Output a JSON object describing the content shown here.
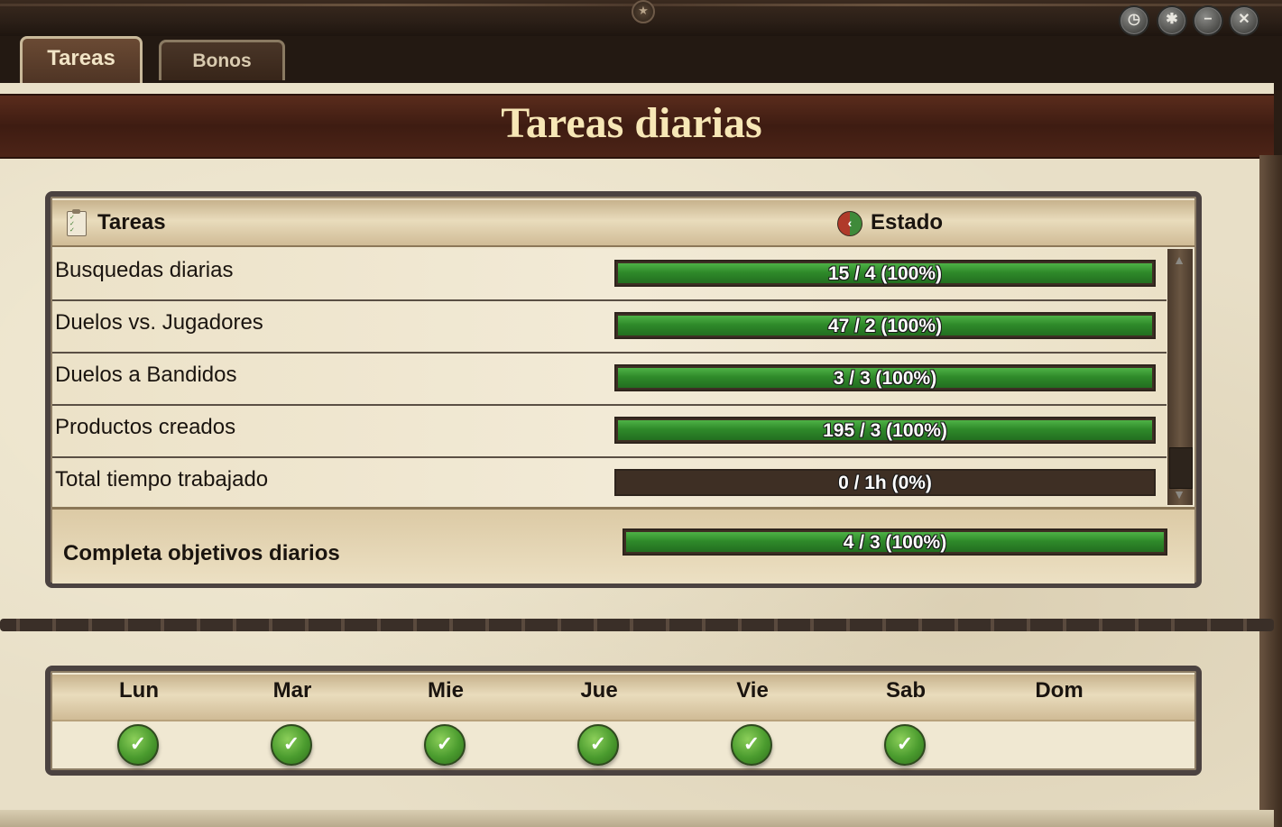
{
  "window": {
    "top_ornament": "star-icon",
    "buttons": [
      {
        "name": "history-button",
        "icon": "clock-icon",
        "glyph": "◷"
      },
      {
        "name": "settings-button",
        "icon": "gear-icon",
        "glyph": "✱"
      },
      {
        "name": "minimize-button",
        "icon": "minus-icon",
        "glyph": "−"
      },
      {
        "name": "close-button",
        "icon": "close-icon",
        "glyph": "✕"
      }
    ]
  },
  "tabs": [
    {
      "label": "Tareas",
      "active": true
    },
    {
      "label": "Bonos",
      "active": false
    }
  ],
  "page": {
    "title": "Tareas diarias"
  },
  "table": {
    "col_tasks": "Tareas",
    "col_status": "Estado",
    "rows": [
      {
        "label": "Busquedas diarias",
        "progress_text": "15 / 4 (100%)",
        "progress": 1.0
      },
      {
        "label": "Duelos vs. Jugadores",
        "progress_text": "47 / 2 (100%)",
        "progress": 1.0
      },
      {
        "label": "Duelos a Bandidos",
        "progress_text": "3 / 3 (100%)",
        "progress": 1.0
      },
      {
        "label": "Productos creados",
        "progress_text": "195 / 3 (100%)",
        "progress": 1.0
      },
      {
        "label": "Total tiempo trabajado",
        "progress_text": "0 / 1h (0%)",
        "progress": 0.0
      }
    ],
    "summary": {
      "label": "Completa objetivos diarios",
      "progress_text": "4 / 3 (100%)",
      "progress": 1.0
    }
  },
  "week": {
    "days": [
      {
        "label": "Lun",
        "done": true
      },
      {
        "label": "Mar",
        "done": true
      },
      {
        "label": "Mie",
        "done": true
      },
      {
        "label": "Jue",
        "done": true
      },
      {
        "label": "Vie",
        "done": true
      },
      {
        "label": "Sab",
        "done": true
      },
      {
        "label": "Dom",
        "done": false
      }
    ]
  },
  "colors": {
    "progress_green": "#2f8a2a",
    "header_band": "#4a2216",
    "title_text": "#f7e7b6"
  }
}
